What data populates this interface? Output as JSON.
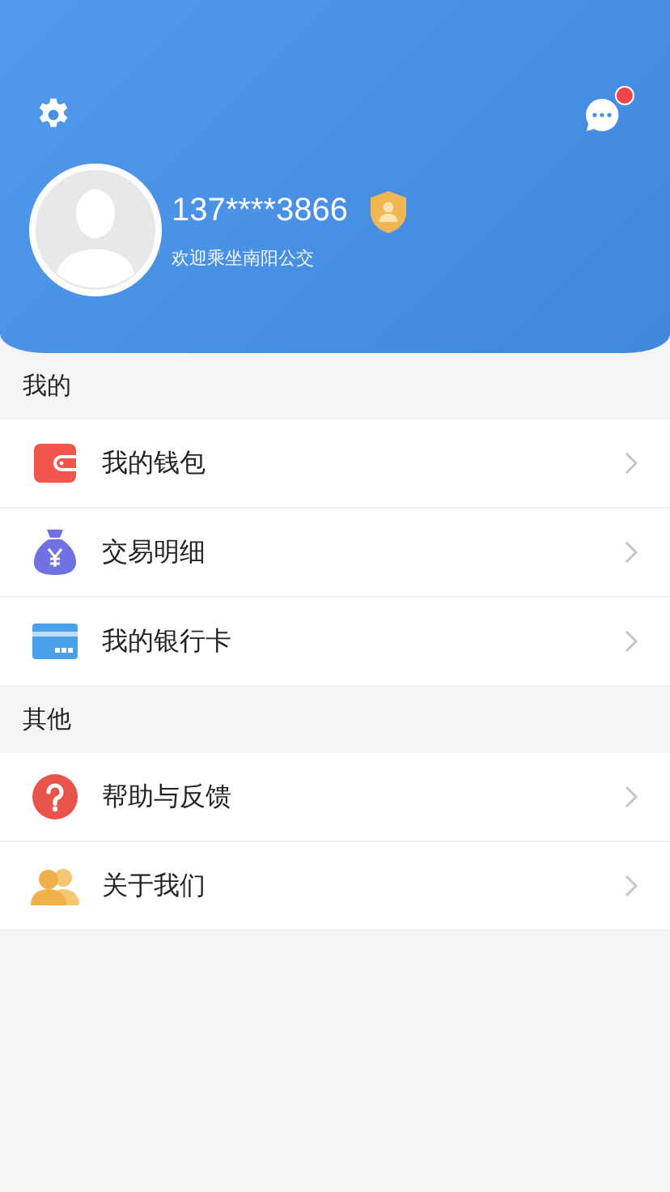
{
  "header": {
    "messages": {
      "unread": true
    },
    "profile": {
      "phone": "137****3866",
      "greeting": "欢迎乘坐南阳公交",
      "verified": true
    }
  },
  "sections": [
    {
      "title": "我的",
      "items": [
        {
          "label": "我的钱包"
        },
        {
          "label": "交易明细"
        },
        {
          "label": "我的银行卡"
        }
      ]
    },
    {
      "title": "其他",
      "items": [
        {
          "label": "帮助与反馈"
        },
        {
          "label": "关于我们"
        }
      ]
    }
  ]
}
